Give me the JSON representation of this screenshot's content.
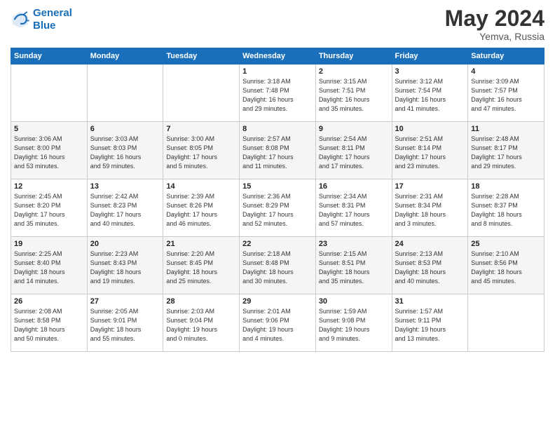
{
  "header": {
    "logo_line1": "General",
    "logo_line2": "Blue",
    "month_year": "May 2024",
    "location": "Yemva, Russia"
  },
  "columns": [
    "Sunday",
    "Monday",
    "Tuesday",
    "Wednesday",
    "Thursday",
    "Friday",
    "Saturday"
  ],
  "weeks": [
    [
      {
        "day": "",
        "info": ""
      },
      {
        "day": "",
        "info": ""
      },
      {
        "day": "",
        "info": ""
      },
      {
        "day": "1",
        "info": "Sunrise: 3:18 AM\nSunset: 7:48 PM\nDaylight: 16 hours\nand 29 minutes."
      },
      {
        "day": "2",
        "info": "Sunrise: 3:15 AM\nSunset: 7:51 PM\nDaylight: 16 hours\nand 35 minutes."
      },
      {
        "day": "3",
        "info": "Sunrise: 3:12 AM\nSunset: 7:54 PM\nDaylight: 16 hours\nand 41 minutes."
      },
      {
        "day": "4",
        "info": "Sunrise: 3:09 AM\nSunset: 7:57 PM\nDaylight: 16 hours\nand 47 minutes."
      }
    ],
    [
      {
        "day": "5",
        "info": "Sunrise: 3:06 AM\nSunset: 8:00 PM\nDaylight: 16 hours\nand 53 minutes."
      },
      {
        "day": "6",
        "info": "Sunrise: 3:03 AM\nSunset: 8:03 PM\nDaylight: 16 hours\nand 59 minutes."
      },
      {
        "day": "7",
        "info": "Sunrise: 3:00 AM\nSunset: 8:05 PM\nDaylight: 17 hours\nand 5 minutes."
      },
      {
        "day": "8",
        "info": "Sunrise: 2:57 AM\nSunset: 8:08 PM\nDaylight: 17 hours\nand 11 minutes."
      },
      {
        "day": "9",
        "info": "Sunrise: 2:54 AM\nSunset: 8:11 PM\nDaylight: 17 hours\nand 17 minutes."
      },
      {
        "day": "10",
        "info": "Sunrise: 2:51 AM\nSunset: 8:14 PM\nDaylight: 17 hours\nand 23 minutes."
      },
      {
        "day": "11",
        "info": "Sunrise: 2:48 AM\nSunset: 8:17 PM\nDaylight: 17 hours\nand 29 minutes."
      }
    ],
    [
      {
        "day": "12",
        "info": "Sunrise: 2:45 AM\nSunset: 8:20 PM\nDaylight: 17 hours\nand 35 minutes."
      },
      {
        "day": "13",
        "info": "Sunrise: 2:42 AM\nSunset: 8:23 PM\nDaylight: 17 hours\nand 40 minutes."
      },
      {
        "day": "14",
        "info": "Sunrise: 2:39 AM\nSunset: 8:26 PM\nDaylight: 17 hours\nand 46 minutes."
      },
      {
        "day": "15",
        "info": "Sunrise: 2:36 AM\nSunset: 8:29 PM\nDaylight: 17 hours\nand 52 minutes."
      },
      {
        "day": "16",
        "info": "Sunrise: 2:34 AM\nSunset: 8:31 PM\nDaylight: 17 hours\nand 57 minutes."
      },
      {
        "day": "17",
        "info": "Sunrise: 2:31 AM\nSunset: 8:34 PM\nDaylight: 18 hours\nand 3 minutes."
      },
      {
        "day": "18",
        "info": "Sunrise: 2:28 AM\nSunset: 8:37 PM\nDaylight: 18 hours\nand 8 minutes."
      }
    ],
    [
      {
        "day": "19",
        "info": "Sunrise: 2:25 AM\nSunset: 8:40 PM\nDaylight: 18 hours\nand 14 minutes."
      },
      {
        "day": "20",
        "info": "Sunrise: 2:23 AM\nSunset: 8:43 PM\nDaylight: 18 hours\nand 19 minutes."
      },
      {
        "day": "21",
        "info": "Sunrise: 2:20 AM\nSunset: 8:45 PM\nDaylight: 18 hours\nand 25 minutes."
      },
      {
        "day": "22",
        "info": "Sunrise: 2:18 AM\nSunset: 8:48 PM\nDaylight: 18 hours\nand 30 minutes."
      },
      {
        "day": "23",
        "info": "Sunrise: 2:15 AM\nSunset: 8:51 PM\nDaylight: 18 hours\nand 35 minutes."
      },
      {
        "day": "24",
        "info": "Sunrise: 2:13 AM\nSunset: 8:53 PM\nDaylight: 18 hours\nand 40 minutes."
      },
      {
        "day": "25",
        "info": "Sunrise: 2:10 AM\nSunset: 8:56 PM\nDaylight: 18 hours\nand 45 minutes."
      }
    ],
    [
      {
        "day": "26",
        "info": "Sunrise: 2:08 AM\nSunset: 8:58 PM\nDaylight: 18 hours\nand 50 minutes."
      },
      {
        "day": "27",
        "info": "Sunrise: 2:05 AM\nSunset: 9:01 PM\nDaylight: 18 hours\nand 55 minutes."
      },
      {
        "day": "28",
        "info": "Sunrise: 2:03 AM\nSunset: 9:04 PM\nDaylight: 19 hours\nand 0 minutes."
      },
      {
        "day": "29",
        "info": "Sunrise: 2:01 AM\nSunset: 9:06 PM\nDaylight: 19 hours\nand 4 minutes."
      },
      {
        "day": "30",
        "info": "Sunrise: 1:59 AM\nSunset: 9:08 PM\nDaylight: 19 hours\nand 9 minutes."
      },
      {
        "day": "31",
        "info": "Sunrise: 1:57 AM\nSunset: 9:11 PM\nDaylight: 19 hours\nand 13 minutes."
      },
      {
        "day": "",
        "info": ""
      }
    ]
  ]
}
